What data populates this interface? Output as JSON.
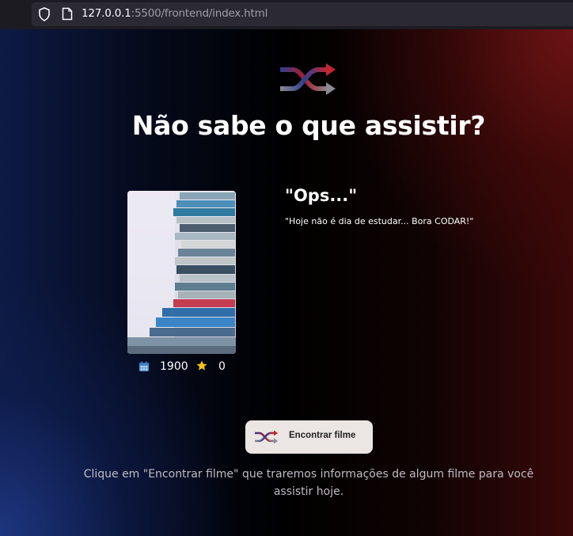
{
  "browser": {
    "url_host": "127.0.0.1",
    "url_rest": ":5500/frontend/index.html"
  },
  "header": {
    "title": "Não sabe o que assistir?",
    "logo_icon": "shuffle-icon"
  },
  "movie": {
    "title": "\"Ops...\"",
    "description": "\"Hoje não é dia de estudar... Bora CODAR!\"",
    "year": "1900",
    "rating": "0",
    "year_icon": "calendar-icon",
    "rating_icon": "star-icon",
    "poster": "stack-of-books-image"
  },
  "action": {
    "button_label": "Encontrar filme",
    "button_icon": "shuffle-icon"
  },
  "hint": {
    "text": "Clique em \"Encontrar filme\" que traremos informações de algum filme para você assistir hoje."
  },
  "colors": {
    "accent_red": "#c2262e",
    "accent_blue": "#2f3f8f",
    "button_bg": "#ebe6e3",
    "star": "#f5c518"
  }
}
